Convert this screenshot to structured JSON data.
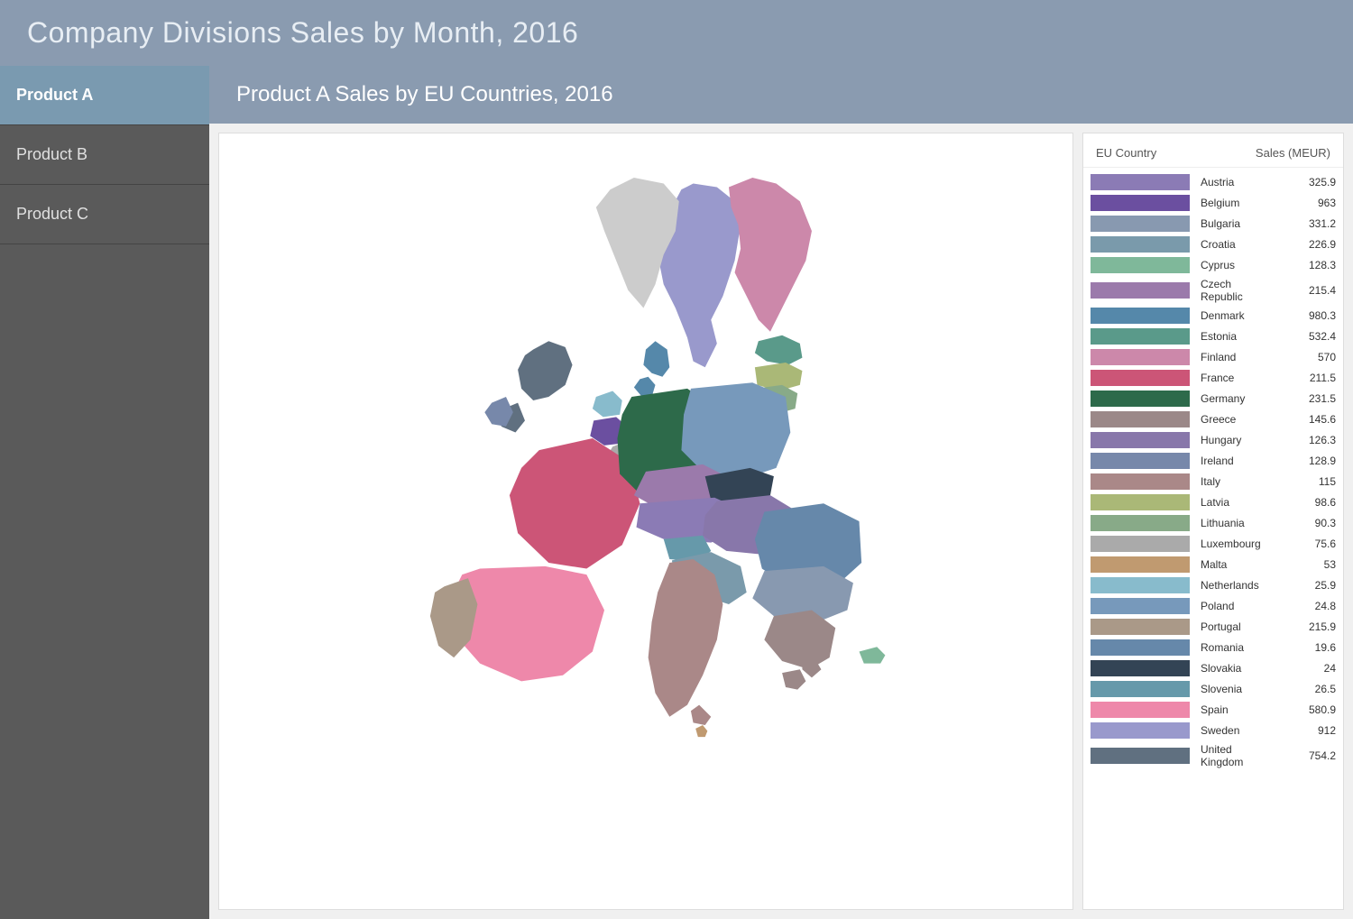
{
  "header": {
    "title": "Company Divisions Sales by Month, 2016"
  },
  "sidebar": {
    "items": [
      {
        "id": "product-a",
        "label": "Product A",
        "active": true
      },
      {
        "id": "product-b",
        "label": "Product B",
        "active": false
      },
      {
        "id": "product-c",
        "label": "Product C",
        "active": false
      }
    ]
  },
  "section": {
    "title": "Product A Sales by EU Countries, 2016"
  },
  "legend": {
    "col1": "EU Country",
    "col2": "Sales (MEUR)",
    "rows": [
      {
        "country": "Austria",
        "value": "325.9",
        "color": "#8b7bb5"
      },
      {
        "country": "Belgium",
        "value": "963",
        "color": "#6b4fa0"
      },
      {
        "country": "Bulgaria",
        "value": "331.2",
        "color": "#8899b0"
      },
      {
        "country": "Croatia",
        "value": "226.9",
        "color": "#7a9aab"
      },
      {
        "country": "Cyprus",
        "value": "128.3",
        "color": "#7fb89a"
      },
      {
        "country": "Czech Republic",
        "value": "215.4",
        "color": "#9b7aab"
      },
      {
        "country": "Denmark",
        "value": "980.3",
        "color": "#5588aa"
      },
      {
        "country": "Estonia",
        "value": "532.4",
        "color": "#5a9a8a"
      },
      {
        "country": "Finland",
        "value": "570",
        "color": "#cc88aa"
      },
      {
        "country": "France",
        "value": "211.5",
        "color": "#cc5577"
      },
      {
        "country": "Germany",
        "value": "231.5",
        "color": "#2d6a4a"
      },
      {
        "country": "Greece",
        "value": "145.6",
        "color": "#9b8888"
      },
      {
        "country": "Hungary",
        "value": "126.3",
        "color": "#8877aa"
      },
      {
        "country": "Ireland",
        "value": "128.9",
        "color": "#7788aa"
      },
      {
        "country": "Italy",
        "value": "115",
        "color": "#aa8888"
      },
      {
        "country": "Latvia",
        "value": "98.6",
        "color": "#aab877"
      },
      {
        "country": "Lithuania",
        "value": "90.3",
        "color": "#88aa88"
      },
      {
        "country": "Luxembourg",
        "value": "75.6",
        "color": "#aaaaaa"
      },
      {
        "country": "Malta",
        "value": "53",
        "color": "#c09a70"
      },
      {
        "country": "Netherlands",
        "value": "25.9",
        "color": "#88bbcc"
      },
      {
        "country": "Poland",
        "value": "24.8",
        "color": "#7799bb"
      },
      {
        "country": "Portugal",
        "value": "215.9",
        "color": "#aa9988"
      },
      {
        "country": "Romania",
        "value": "19.6",
        "color": "#6688aa"
      },
      {
        "country": "Slovakia",
        "value": "24",
        "color": "#334455"
      },
      {
        "country": "Slovenia",
        "value": "26.5",
        "color": "#6699aa"
      },
      {
        "country": "Spain",
        "value": "580.9",
        "color": "#ee88aa"
      },
      {
        "country": "Sweden",
        "value": "912",
        "color": "#9999cc"
      },
      {
        "country": "United Kingdom",
        "value": "754.2",
        "color": "#607080"
      }
    ]
  }
}
